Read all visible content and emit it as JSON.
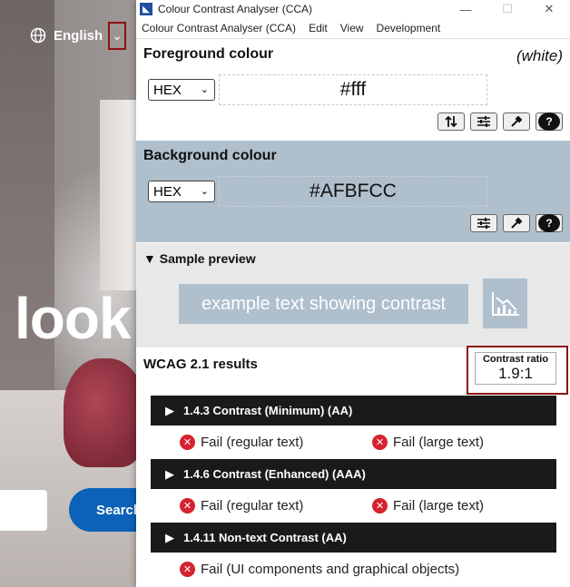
{
  "website": {
    "language": "English",
    "language_chevron": "⌄",
    "hero_text": "look",
    "search_button": "Search"
  },
  "window": {
    "title": "Colour Contrast Analyser (CCA)",
    "menu": [
      "Colour Contrast Analyser (CCA)",
      "Edit",
      "View",
      "Development"
    ]
  },
  "foreground": {
    "title": "Foreground colour",
    "name": "(white)",
    "format": "HEX",
    "value": "#fff"
  },
  "background": {
    "title": "Background colour",
    "format": "HEX",
    "value": "#AFBFCC"
  },
  "preview": {
    "title": "Sample preview",
    "toggle": "▼",
    "sample_text": "example text showing contrast"
  },
  "results": {
    "title": "WCAG 2.1 results",
    "ratio_label": "Contrast ratio",
    "ratio_value": "1.9:1",
    "criteria": [
      {
        "label": "1.4.3 Contrast (Minimum) (AA)",
        "results": [
          "Fail (regular text)",
          "Fail (large text)"
        ]
      },
      {
        "label": "1.4.6 Contrast (Enhanced) (AAA)",
        "results": [
          "Fail (regular text)",
          "Fail (large text)"
        ]
      },
      {
        "label": "1.4.11 Non-text Contrast (AA)",
        "results": [
          "Fail (UI components and graphical objects)"
        ]
      }
    ]
  },
  "colors": {
    "background_sample": "#AFBFCC",
    "fail": "#d4232f",
    "highlight": "#8b1111"
  }
}
